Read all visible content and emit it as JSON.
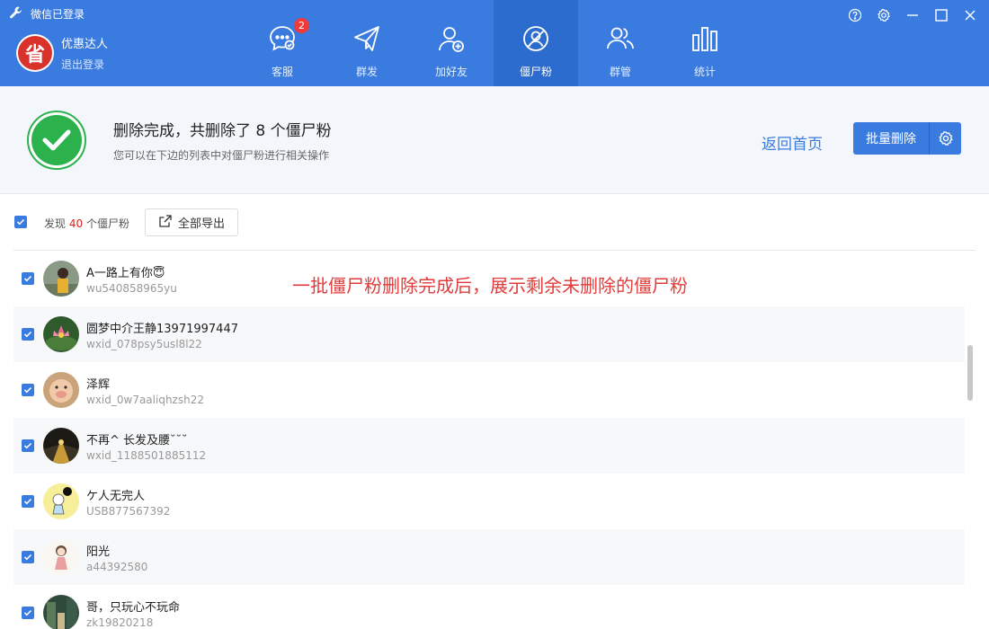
{
  "app": {
    "title": "微信已登录",
    "profile": {
      "name": "优惠达人",
      "logout": "退出登录",
      "logo_char": "省"
    }
  },
  "nav": [
    {
      "label": "客服",
      "icon": "chat-icon",
      "badge": "2"
    },
    {
      "label": "群发",
      "icon": "send-icon"
    },
    {
      "label": "加好友",
      "icon": "add-user-icon"
    },
    {
      "label": "僵尸粉",
      "icon": "zombie-fan-icon",
      "active": true
    },
    {
      "label": "群管",
      "icon": "group-icon"
    },
    {
      "label": "统计",
      "icon": "stats-icon"
    }
  ],
  "window_controls": [
    "help-icon",
    "settings-icon",
    "minimize-icon",
    "maximize-icon",
    "close-icon"
  ],
  "result": {
    "title": "删除完成，共删除了 8 个僵尸粉",
    "subtitle": "您可以在下边的列表中对僵尸粉进行相关操作",
    "back_home": "返回首页",
    "batch_delete": "批量删除"
  },
  "toolbar": {
    "found_prefix": "发现",
    "found_count": "40",
    "found_suffix": "个僵尸粉",
    "export_all": "全部导出"
  },
  "annotation": "一批僵尸粉删除完成后，展示剩余未删除的僵尸粉",
  "contacts": [
    {
      "name": "A一路上有你😇",
      "wxid": "wu540858965yu",
      "avatar": "person-photo"
    },
    {
      "name": "圆梦中介王静13971997447",
      "wxid": "wxid_078psy5usl8l22",
      "avatar": "lotus-photo"
    },
    {
      "name": "泽辉",
      "wxid": "wxid_0w7aaliqhzsh22",
      "avatar": "pig-photo"
    },
    {
      "name": "不再^ 长发及腰˘˘˘",
      "wxid": "wxid_1188501885112",
      "avatar": "road-photo"
    },
    {
      "name": "ケ人无完人",
      "wxid": "USB877567392",
      "avatar": "cartoon-photo"
    },
    {
      "name": "阳光",
      "wxid": "a44392580",
      "avatar": "girl-drawing"
    },
    {
      "name": "哥，只玩心不玩命",
      "wxid": "zk19820218",
      "avatar": "scene-photo"
    }
  ],
  "colors": {
    "header": "#3a7be0",
    "active_nav": "#2c6ccf",
    "success": "#2bb24c",
    "accent": "#3a7be0",
    "annotation": "#e23b3b",
    "count": "#e02020"
  }
}
